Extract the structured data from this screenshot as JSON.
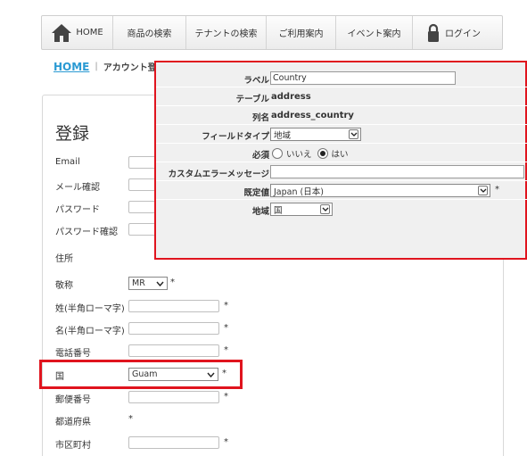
{
  "nav": {
    "home": "HOME",
    "product_search": "商品の検索",
    "tenant_search": "テナントの検索",
    "usage_guide": "ご利用案内",
    "event_guide": "イベント案内",
    "login": "ログイン"
  },
  "breadcrumb": {
    "home": "HOME",
    "separator": "|",
    "current": "アカウント登録"
  },
  "form": {
    "title": "登録",
    "email_label": "Email",
    "email_confirm_label": "メール確認",
    "password_label": "パスワード",
    "password_confirm_label": "パスワード確認",
    "address_label": "住所",
    "title_honorific_label": "敬称",
    "title_honorific_value": "MR",
    "last_name_label": "姓(半角ローマ字)",
    "first_name_label": "名(半角ローマ字)",
    "phone_label": "電話番号",
    "country_label": "国",
    "country_value": "Guam",
    "postal_label": "郵便番号",
    "prefecture_label": "都道府県",
    "city_label": "市区町村",
    "required_mark": "*"
  },
  "properties": {
    "label_label": "ラベル",
    "label_value": "Country",
    "table_label": "テーブル",
    "table_value": "address",
    "column_label": "列名",
    "column_value": "address_country",
    "field_type_label": "フィールドタイプ",
    "field_type_value": "地域",
    "required_label": "必須",
    "required_no": "いいえ",
    "required_yes": "はい",
    "custom_error_label": "カスタムエラーメッセージ",
    "custom_error_value": "",
    "default_label": "既定値",
    "default_value": "Japan (日本)",
    "region_label": "地域",
    "region_value": "国",
    "required_mark": "*"
  },
  "colors": {
    "accent_red": "#e0141e",
    "link_blue": "#2a9ad3"
  }
}
